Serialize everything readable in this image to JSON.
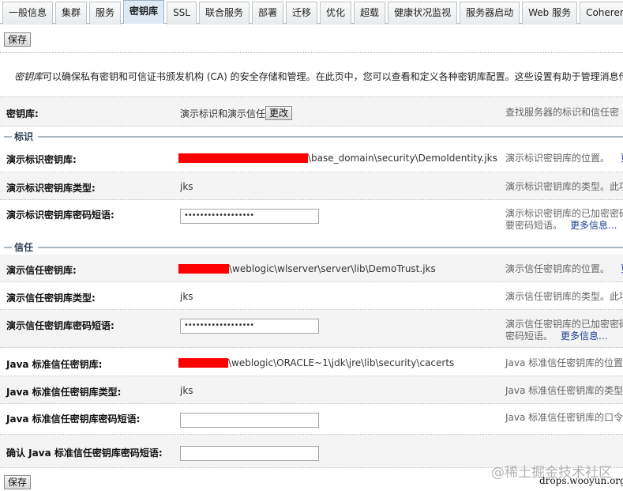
{
  "tabs": [
    "一般信息",
    "集群",
    "服务",
    "密钥库",
    "SSL",
    "联合服务",
    "部署",
    "迁移",
    "优化",
    "超载",
    "健康状况监视",
    "服务器启动",
    "Web 服务",
    "Coherence"
  ],
  "active_tab": "密钥库",
  "save_label": "保存",
  "description": {
    "em": "密钥库",
    "text": "可以确保私有密钥和可信证书颁发机构 (CA) 的安全存储和管理。在此页中，您可以查看和定义各种密钥库配置。这些设置有助于管理消息传"
  },
  "keystore": {
    "label": "密钥库:",
    "value": "演示标识和演示信任",
    "change_label": "更改",
    "help": "查找服务器的标识和信任密"
  },
  "identity": {
    "title": "标识",
    "rows": [
      {
        "label": "演示标识密钥库:",
        "value": "\\base_domain\\security\\DemoIdentity.jks",
        "help": "演示标识密钥库的位置。",
        "more": "更"
      },
      {
        "label": "演示标识密钥库类型:",
        "value": "jks",
        "help": "演示标识密钥库的类型。此项"
      },
      {
        "label": "演示标识密钥库密码短语:",
        "value": "••••••••••••••••••",
        "help": "演示标识密钥库的已加密密码",
        "help2": "要密码短语。",
        "more": "更多信息..."
      }
    ]
  },
  "trust": {
    "title": "信任",
    "rows": [
      {
        "label": "演示信任密钥库:",
        "value": "\\weblogic\\wlserver\\server\\lib\\DemoTrust.jks",
        "help": "演示信任密钥库的位置。",
        "more": "更"
      },
      {
        "label": "演示信任密钥库类型:",
        "value": "jks",
        "help": "演示信任密钥库的类型。此项"
      },
      {
        "label": "演示信任密钥库密码短语:",
        "value": "••••••••••••••••••",
        "help": "演示信任密钥库的已加密密码",
        "help2": "密码短语。",
        "more": "更多信息..."
      },
      {
        "label": "Java 标准信任密钥库:",
        "value": "\\weblogic\\ORACLE~1\\jdk\\jre\\lib\\security\\cacerts",
        "help": "Java 标准信任密钥库的位置"
      },
      {
        "label": "Java 标准信任密钥库类型:",
        "value": "jks",
        "help": "Java 标准信任密钥库的类型"
      },
      {
        "label": "Java 标准信任密钥库密码短语:",
        "value": "",
        "help": "Java 标准信任密钥库的口令"
      },
      {
        "label": "确认 Java 标准信任密钥库密码短语:",
        "value": ""
      }
    ]
  },
  "watermark": {
    "line1": "@稀土掘金技术社区",
    "line2": "drops.wooyun.org"
  },
  "colors": {
    "redaction": "#ff0000",
    "link": "#1f3f8f"
  }
}
